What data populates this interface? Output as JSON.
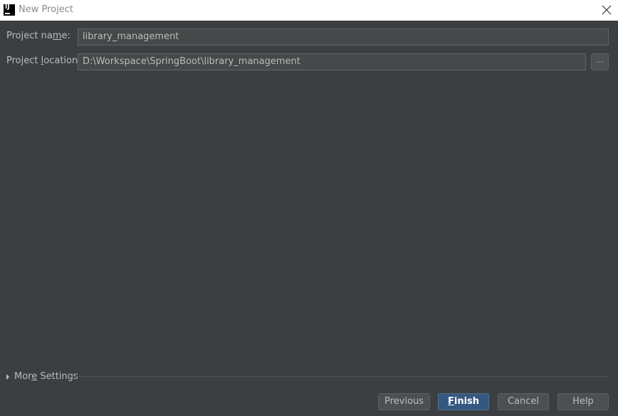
{
  "window": {
    "title": "New Project",
    "icon": "intellij-idea-icon",
    "icon_text": "IJ"
  },
  "form": {
    "project_name": {
      "label_pre": "Project na",
      "label_mnemonic": "m",
      "label_post": "e:",
      "value": "library_management"
    },
    "project_location": {
      "label_pre": "Project ",
      "label_mnemonic": "l",
      "label_post": "ocation:",
      "value": "D:\\Workspace\\SpringBoot\\library_management",
      "browse_label": "..."
    }
  },
  "more_settings": {
    "label_pre": "Mor",
    "label_mnemonic": "e",
    "label_post": " Settings",
    "expanded": false
  },
  "buttons": {
    "previous": "Previous",
    "finish_mnemonic": "F",
    "finish_rest": "inish",
    "cancel": "Cancel",
    "help": "Help"
  },
  "colors": {
    "background": "#3c3f41",
    "titlebar": "#ffffff",
    "primary_button": "#365880"
  }
}
